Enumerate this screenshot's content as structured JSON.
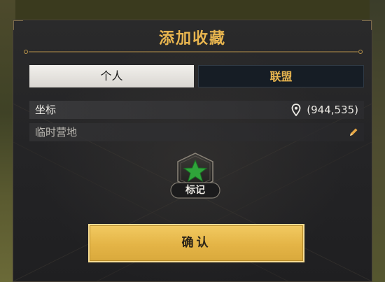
{
  "dialog": {
    "title": "添加收藏"
  },
  "tabs": [
    {
      "label": "个人",
      "active": true
    },
    {
      "label": "联盟",
      "active": false
    }
  ],
  "coordinate": {
    "label": "坐标",
    "value": "(944,535)",
    "icon": "location-pin-icon"
  },
  "name_field": {
    "value": "临时营地",
    "icon": "pencil-icon"
  },
  "marker": {
    "label": "标记",
    "icon": "green-star-icon",
    "color": "#2fa43a"
  },
  "confirm": {
    "label": "确认"
  },
  "colors": {
    "accent_gold": "#e8b54f",
    "panel_bg": "#242426",
    "button_gold": "#e4b446"
  }
}
